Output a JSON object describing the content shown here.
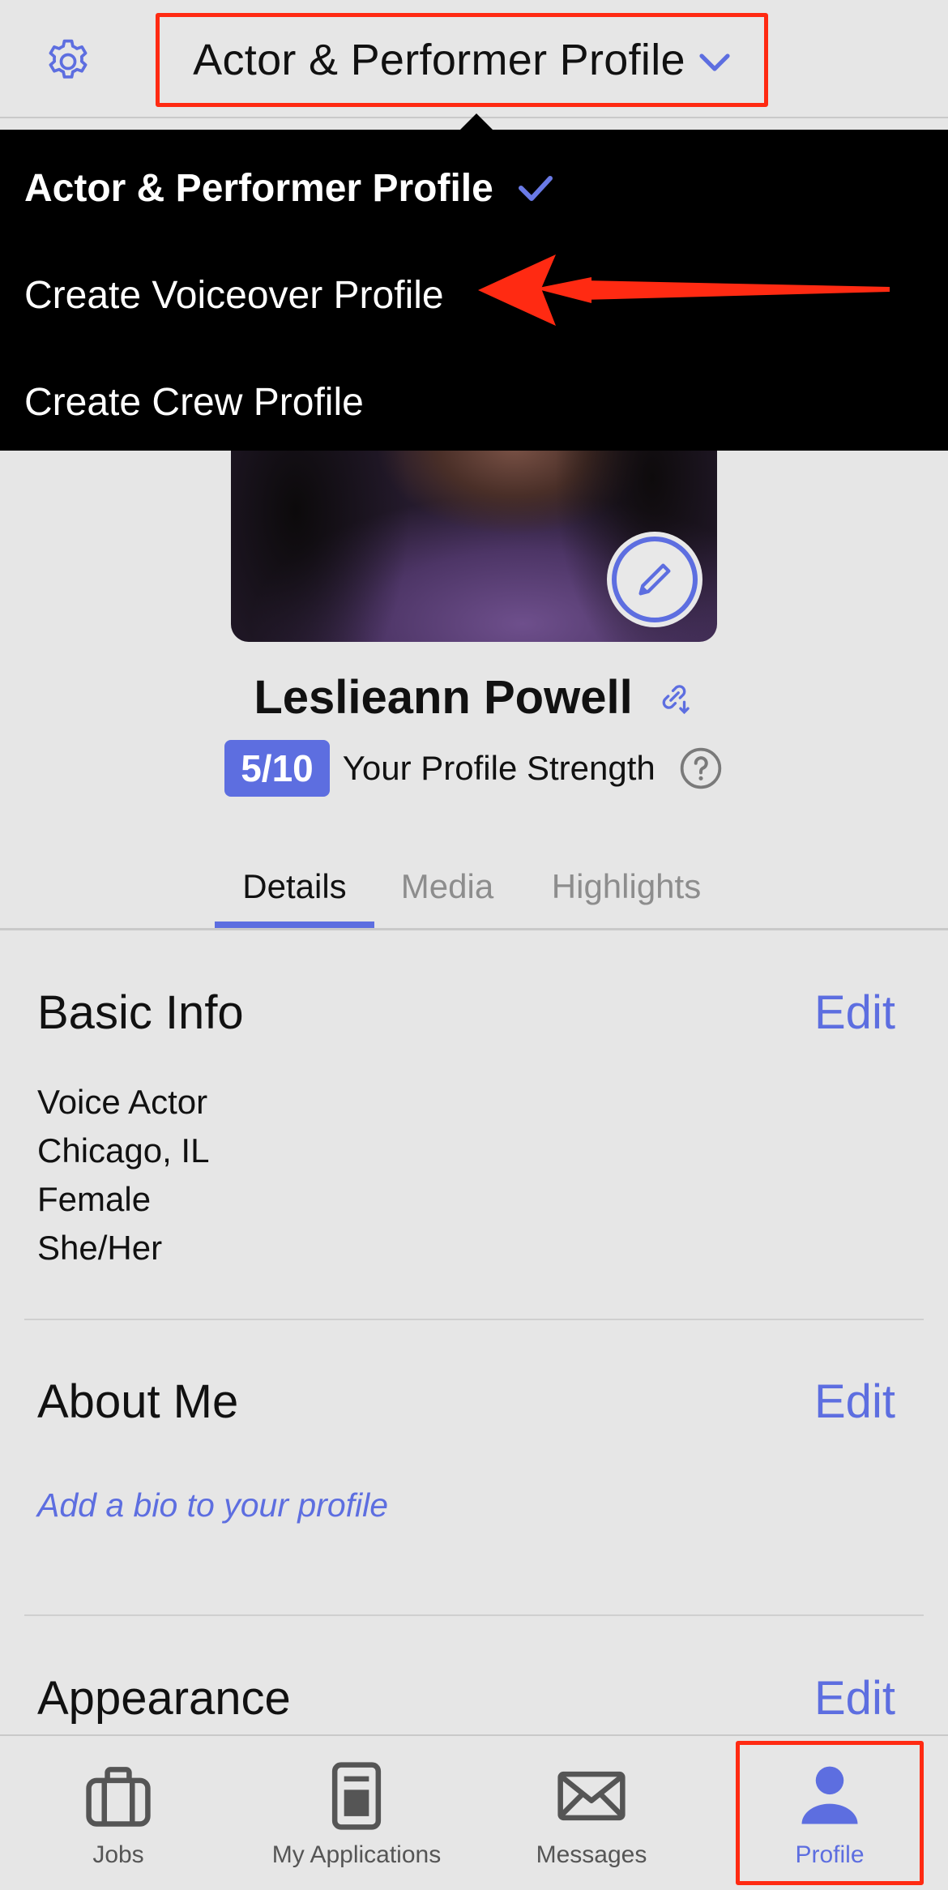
{
  "header": {
    "title": "Actor & Performer Profile",
    "settings_icon": "gear-icon",
    "chevron_icon": "chevron-down-icon"
  },
  "profile_switcher": {
    "items": [
      {
        "label": "Actor & Performer Profile",
        "selected": true,
        "icon": "checkmark-icon"
      },
      {
        "label": "Create Voiceover Profile",
        "selected": false
      },
      {
        "label": "Create Crew Profile",
        "selected": false
      }
    ]
  },
  "profile": {
    "name": "Leslieann Powell",
    "link_icon": "link-icon",
    "edit_photo_icon": "pencil-icon",
    "strength_value": "5/10",
    "strength_label": "Your Profile Strength",
    "help_icon": "question-circle-icon"
  },
  "tabs": [
    {
      "label": "Details",
      "active": true
    },
    {
      "label": "Media",
      "active": false
    },
    {
      "label": "Highlights",
      "active": false
    }
  ],
  "sections": {
    "basic_info": {
      "title": "Basic Info",
      "edit_label": "Edit",
      "lines": [
        "Voice Actor",
        "Chicago, IL",
        "Female",
        "She/Her"
      ]
    },
    "about_me": {
      "title": "About Me",
      "edit_label": "Edit",
      "prompt": "Add a bio to your profile"
    },
    "appearance": {
      "title": "Appearance",
      "edit_label": "Edit"
    }
  },
  "bottom_nav": [
    {
      "label": "Jobs",
      "icon": "briefcase-icon",
      "active": false
    },
    {
      "label": "My Applications",
      "icon": "clipboard-icon",
      "active": false
    },
    {
      "label": "Messages",
      "icon": "envelope-icon",
      "active": false
    },
    {
      "label": "Profile",
      "icon": "person-icon",
      "active": true
    }
  ],
  "colors": {
    "accent": "#5d6ee0",
    "annotation": "#ff2a12",
    "background": "#e6e6e6",
    "menu_bg": "#000000"
  }
}
